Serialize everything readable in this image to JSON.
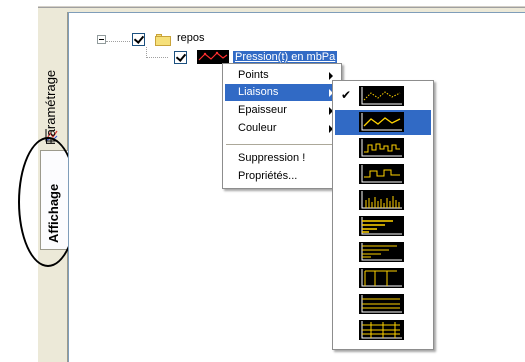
{
  "tabs": {
    "parametrage": "Paramétrage",
    "affichage": "Affichage"
  },
  "tree": {
    "root": {
      "label": "repos",
      "checked": true,
      "expanded": true,
      "icon": "folder-icon"
    },
    "series": {
      "label": "Pression(t) en mbPa",
      "checked": true,
      "selected": true,
      "icon": "series-thumbnail-icon"
    }
  },
  "context_menu": {
    "items": [
      {
        "label": "Points",
        "has_submenu": true
      },
      {
        "label": "Liaisons",
        "has_submenu": true,
        "highlighted": true
      },
      {
        "label": "Epaisseur",
        "has_submenu": true
      },
      {
        "label": "Couleur",
        "has_submenu": true
      },
      {
        "label": "Suppression !",
        "has_submenu": false
      },
      {
        "label": "Propriétés...",
        "has_submenu": false
      }
    ]
  },
  "submenu": {
    "checked_index": 0,
    "highlighted_index": 1,
    "options": [
      "line-dotted-icon",
      "line-segments-icon",
      "line-steps-icon",
      "line-steps-wide-icon",
      "line-bars-icon",
      "line-horizontal-bars-icon",
      "line-area-steps-icon",
      "line-vertical-steps-icon",
      "line-horizontal-lines-icon",
      "line-grid-icon"
    ]
  },
  "colors": {
    "selection": "#316ac5",
    "thumb_background": "#000000",
    "thumb_stroke": "#ffd200",
    "annotation": "#000000"
  }
}
